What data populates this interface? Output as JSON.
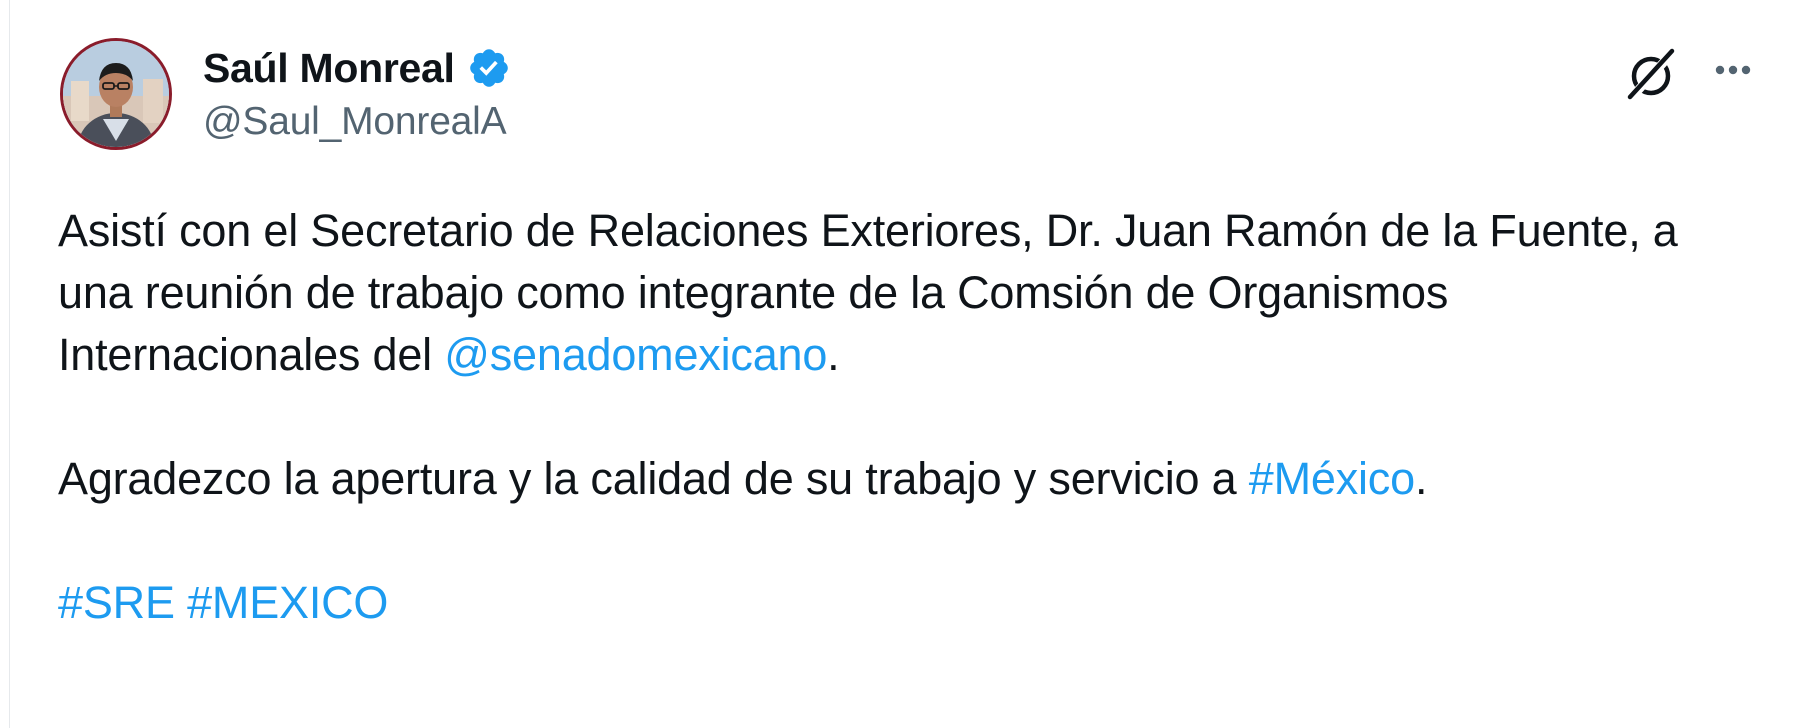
{
  "author": {
    "display_name": "Saúl Monreal",
    "handle": "@Saul_MonrealA",
    "verified_badge": "verified-icon",
    "avatar": "avatar"
  },
  "actions": {
    "grok_icon": "grok-icon",
    "more_icon": "more-icon"
  },
  "tweet": {
    "p1_text": "Asistí con el Secretario de Relaciones Exteriores, Dr. Juan Ramón de la Fuente, a una reunión de trabajo como integrante de la Comsión de Organismos Internacionales del ",
    "p1_mention": "@senadomexicano",
    "p1_end": ".",
    "p2_text": "Agradezco la apertura y la calidad de su trabajo y servicio a ",
    "p2_hashtag": "#México",
    "p2_end": ".",
    "hashtag_sre": "#SRE",
    "hashtag_mexico": "#MEXICO"
  },
  "colors": {
    "text": "#0f1419",
    "secondary_text": "#536471",
    "link": "#1d9bf0",
    "avatar_ring": "#8a1c2b",
    "verified": "#1d9bf0"
  }
}
